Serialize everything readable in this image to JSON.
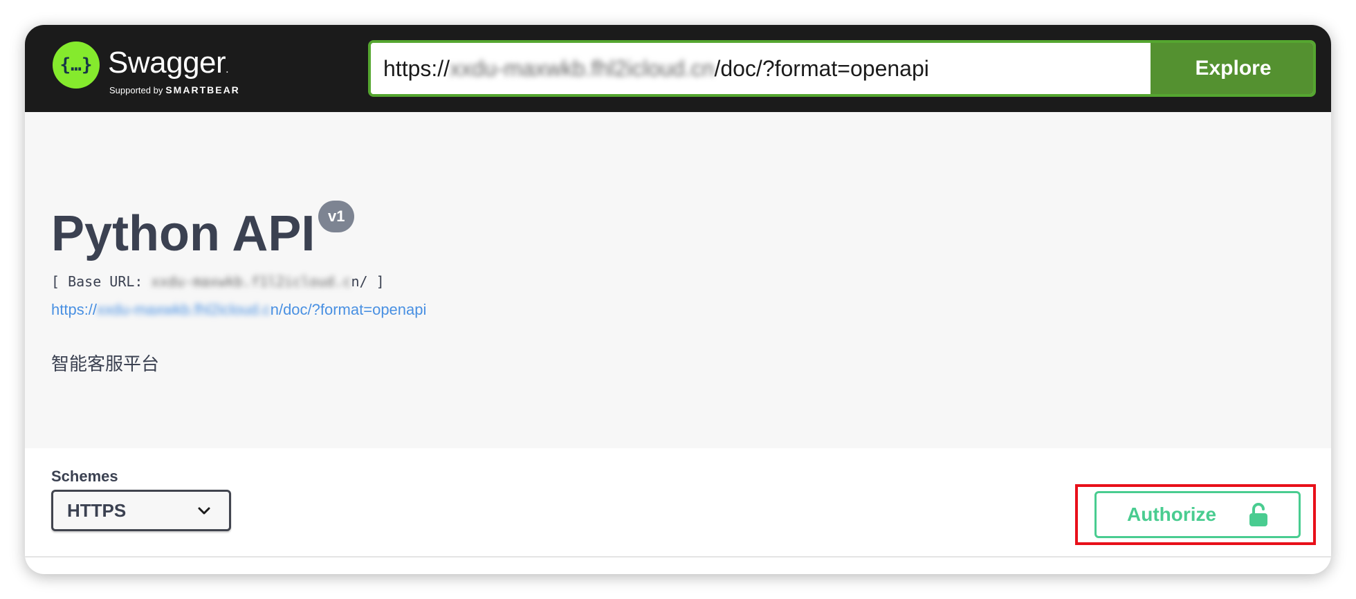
{
  "header": {
    "brand": "Swagger",
    "brand_mark": ".",
    "supported_by": "Supported by",
    "smartbear": "SMARTBEAR",
    "url_prefix": "https://",
    "url_blurred": "xxdu-maxwkb.fhl2icloud.cn",
    "url_suffix": "/doc/?format=openapi",
    "explore_label": "Explore"
  },
  "info": {
    "title": "Python API",
    "version": "v1",
    "base_url_prefix": "[ Base URL: ",
    "base_url_blurred": "xxdu-maxwkb.f1l2icloud.c",
    "base_url_suffix": "n/ ]",
    "link_prefix": "https://",
    "link_blurred": "xxdu-maxwkb.fhl2icloud.c",
    "link_suffix": "n/doc/?format=openapi",
    "description": "智能客服平台"
  },
  "schemes": {
    "label": "Schemes",
    "selected": "HTTPS"
  },
  "authorize": {
    "label": "Authorize",
    "highlight_color": "#e8101a",
    "accent_color": "#49cc90"
  },
  "icons": {
    "logo": "swagger-logo-icon",
    "chevron": "chevron-down-icon",
    "lock": "unlocked-padlock-icon"
  }
}
